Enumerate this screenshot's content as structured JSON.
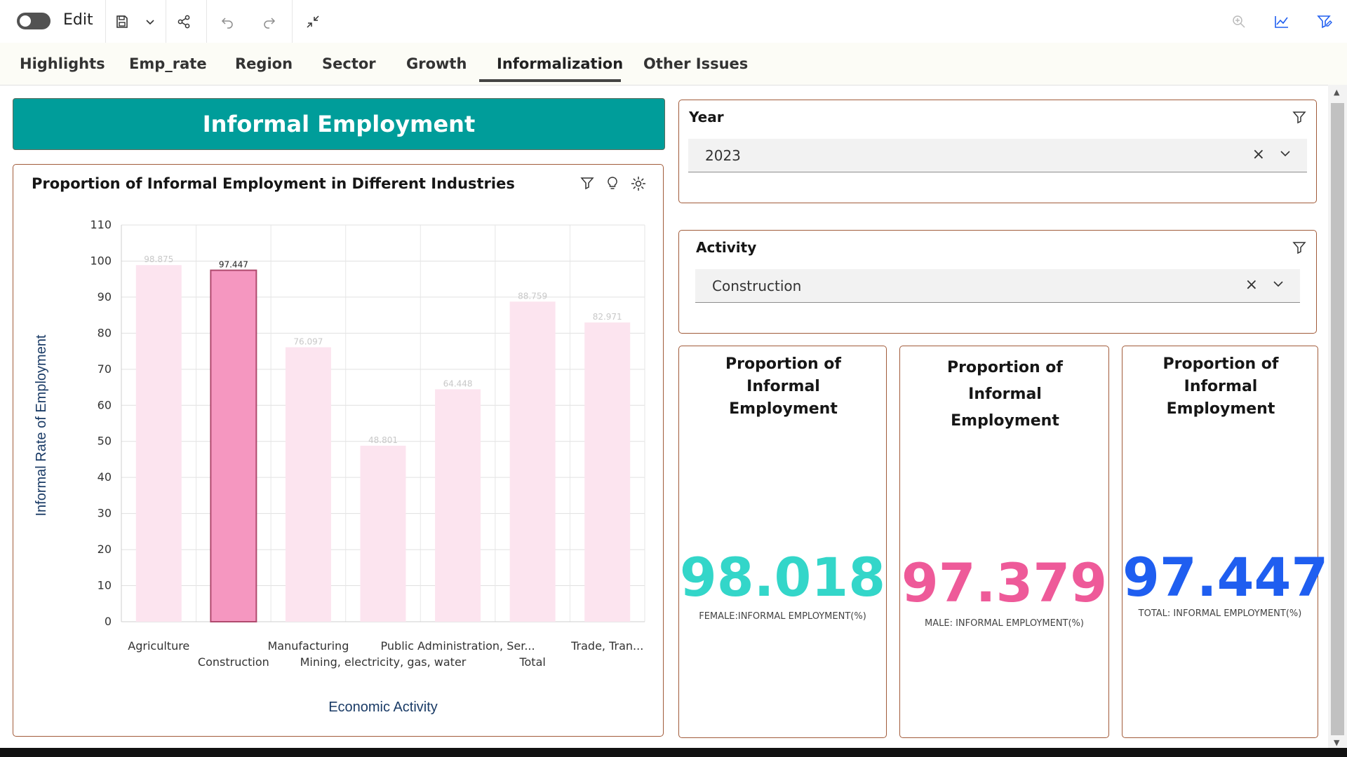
{
  "toolbar": {
    "edit_label": "Edit"
  },
  "tabs": [
    {
      "label": "Highlights"
    },
    {
      "label": "Emp_rate"
    },
    {
      "label": "Region"
    },
    {
      "label": "Sector"
    },
    {
      "label": "Growth"
    },
    {
      "label": "Informalization"
    },
    {
      "label": "Other Issues"
    }
  ],
  "active_tab": "Informalization",
  "banner": {
    "title": "Informal Employment",
    "color": "#009d9a"
  },
  "chart_card": {
    "title": "Proportion of Informal Employment in Different Industries"
  },
  "chart_data": {
    "type": "bar",
    "title": "Proportion of Informal Employment in Different Industries",
    "xlabel": "Economic Activity",
    "ylabel": "Informal Rate of Employment",
    "ylim": [
      0,
      110
    ],
    "yticks": [
      0,
      10,
      20,
      30,
      40,
      50,
      60,
      70,
      80,
      90,
      100,
      110
    ],
    "grid": true,
    "categories": [
      "Agriculture",
      "Construction",
      "Manufacturing",
      "Mining, electricity, gas, water",
      "Public Administration, Ser...",
      "Total",
      "Trade, Tran..."
    ],
    "values": [
      98.875,
      97.447,
      76.097,
      48.801,
      64.448,
      88.759,
      82.971
    ],
    "highlighted": "Construction",
    "colors": {
      "bar": "#fce4ef",
      "highlight": "#f597c0",
      "highlight_border": "#b04a6e",
      "faded_label": "#c8c8c8"
    }
  },
  "filters": {
    "year": {
      "label": "Year",
      "value": "2023"
    },
    "activity": {
      "label": "Activity",
      "value": "Construction"
    }
  },
  "kpis": [
    {
      "title": "Proportion of Informal Employment",
      "value": "98.018",
      "label": "FEMALE:INFORMAL EMPLOYMENT(%)",
      "color": "#33d6c9"
    },
    {
      "title": "Proportion of Informal Employment",
      "value": "97.379",
      "label": "MALE: INFORMAL EMPLOYMENT(%)",
      "color": "#ee5a99"
    },
    {
      "title": "Proportion of Informal Employment",
      "value": "97.447",
      "label": "TOTAL: INFORMAL EMPLOYMENT(%)",
      "color": "#1f5ef0"
    }
  ]
}
